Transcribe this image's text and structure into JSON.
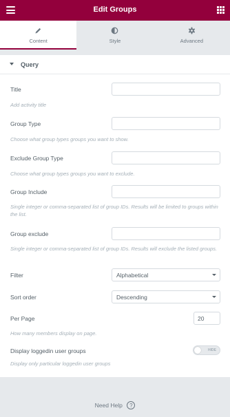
{
  "header": {
    "title": "Edit Groups",
    "menu_icon": "hamburger-icon",
    "grid_icon": "apps-grid-icon",
    "brand_color": "#93003c"
  },
  "tabs": [
    {
      "label": "Content",
      "icon": "pencil-icon",
      "active": true
    },
    {
      "label": "Style",
      "icon": "half-circle-icon",
      "active": false
    },
    {
      "label": "Advanced",
      "icon": "gear-icon",
      "active": false
    }
  ],
  "section": {
    "title": "Query"
  },
  "fields": {
    "title": {
      "label": "Title",
      "value": "",
      "description": "Add activity title"
    },
    "group_type": {
      "label": "Group Type",
      "value": "",
      "description": "Choose what group types groups you want to show."
    },
    "exclude_group_type": {
      "label": "Exclude Group Type",
      "value": "",
      "description": "Choose what group types groups you want to exclude."
    },
    "group_include": {
      "label": "Group Include",
      "value": "",
      "description": "Single integer or comma-separated list of group IDs. Results will be limited to groups within the list."
    },
    "group_exclude": {
      "label": "Group exclude",
      "value": "",
      "description": "Single integer or comma-separated list of group IDs. Results will exclude the listed groups."
    },
    "filter": {
      "label": "Filter",
      "value": "Alphabetical"
    },
    "sort_order": {
      "label": "Sort order",
      "value": "Descending"
    },
    "per_page": {
      "label": "Per Page",
      "value": "20",
      "description": "How many members display on page."
    },
    "display_loggedin": {
      "label": "Display loggedin user groups",
      "toggle_text": "HIDE",
      "description": "Display only particular loggedin user groups"
    }
  },
  "footer": {
    "help_label": "Need Help",
    "help_icon": "question-circle-icon"
  }
}
